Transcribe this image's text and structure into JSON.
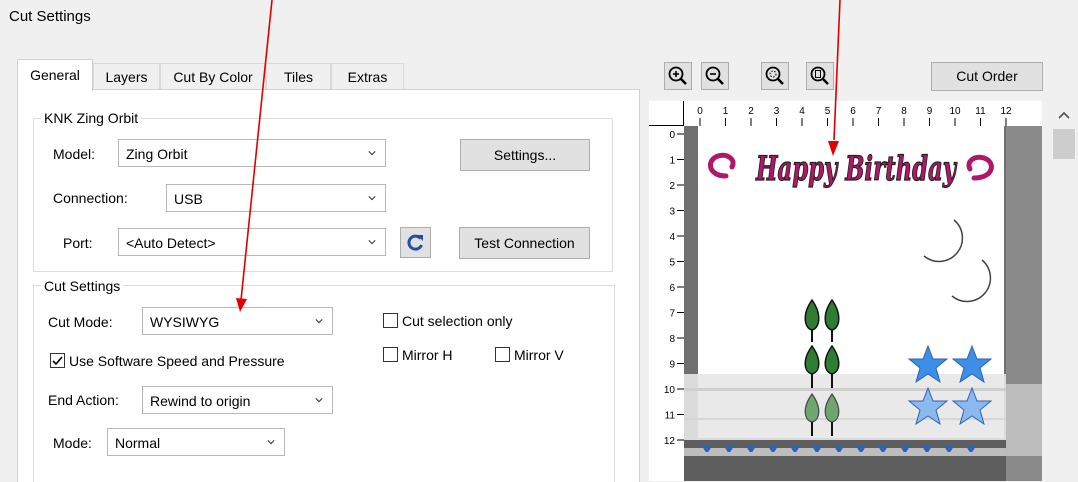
{
  "window": {
    "title": "Cut Settings"
  },
  "tabs": [
    {
      "label": "General"
    },
    {
      "label": "Layers"
    },
    {
      "label": "Cut By Color"
    },
    {
      "label": "Tiles"
    },
    {
      "label": "Extras"
    }
  ],
  "cutter_group": {
    "title": "KNK Zing Orbit",
    "model_label": "Model:",
    "model_value": "Zing Orbit",
    "settings_button": "Settings...",
    "connection_label": "Connection:",
    "connection_value": "USB",
    "port_label": "Port:",
    "port_value": "<Auto Detect>",
    "test_button": "Test Connection"
  },
  "cut_settings": {
    "title": "Cut Settings",
    "cut_mode_label": "Cut Mode:",
    "cut_mode_value": "WYSIWYG",
    "cut_selection_label": "Cut selection only",
    "use_speed_label": "Use Software Speed and Pressure",
    "use_speed_checked": true,
    "mirror_h_label": "Mirror H",
    "mirror_v_label": "Mirror V",
    "end_action_label": "End Action:",
    "end_action_value": "Rewind to origin",
    "mode_label": "Mode:",
    "mode_value": "Normal"
  },
  "preview": {
    "cut_order_button": "Cut Order",
    "zoom_icons": [
      "zoom-in-icon",
      "zoom-out-icon",
      "zoom-fit-icon",
      "zoom-page-icon"
    ],
    "ruler_top": [
      "0",
      "1",
      "2",
      "3",
      "4",
      "5",
      "6",
      "7",
      "8",
      "9",
      "10",
      "11",
      "12"
    ],
    "ruler_left": [
      "0",
      "1",
      "2",
      "3",
      "4",
      "5",
      "6",
      "7",
      "8",
      "9",
      "10",
      "11",
      "12"
    ],
    "design_text": "Happy Birthday"
  },
  "colors": {
    "arrow": "#e00000",
    "text_magenta": "#b0166a",
    "moon": "#f5c400",
    "star": "#3d8ee6",
    "leaf": "#2e7d32",
    "marker": "#2d63b3"
  }
}
